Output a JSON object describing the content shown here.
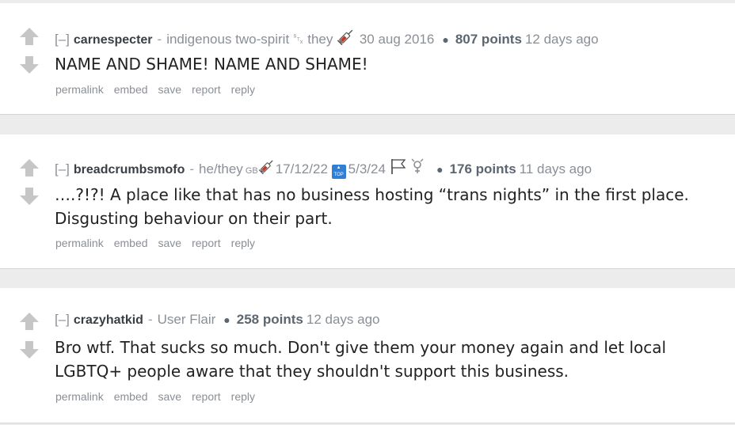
{
  "actions": [
    "permalink",
    "embed",
    "save",
    "report",
    "reply"
  ],
  "comments": [
    {
      "collapse": "[–]",
      "username": "carnespecter",
      "flair": "indigenous two-spirit ␂ they",
      "flair_date": "30 aug 2016",
      "points": "807 points",
      "time": "12 days ago",
      "body": "NAME AND SHAME! NAME AND SHAME!",
      "icons": [
        "syringe-icon"
      ]
    },
    {
      "collapse": "[–]",
      "username": "breadcrumbsmofo",
      "flair": "he/they",
      "flair_gb": "GB",
      "flair_date1": "17/12/22",
      "flair_top": "TOP",
      "flair_date2": "5/3/24",
      "points": "176 points",
      "time": "11 days ago",
      "body": "….?!?! A place like that has no business hosting “trans nights” in the first place. Disgusting behaviour on their part.",
      "icons": [
        "syringe-icon",
        "top-arrow-icon",
        "flag-icon",
        "transgender-symbol-icon"
      ]
    },
    {
      "collapse": "[–]",
      "username": "crazyhatkid",
      "flair": "User Flair",
      "points": "258 points",
      "time": "12 days ago",
      "body": "Bro wtf. That sucks so much. Don't give them your money again and let local LGBTQ+ people aware that they shouldn't support this business."
    }
  ],
  "colors": {
    "page_bg": "#ececec",
    "card_bg": "#ffffff",
    "arrow": "#c6c6c6",
    "username": "#3a3f45",
    "meta": "#8a8f96",
    "body_text": "#222222",
    "syringe": "#c0392b",
    "top_badge": "#2f7fd6"
  }
}
